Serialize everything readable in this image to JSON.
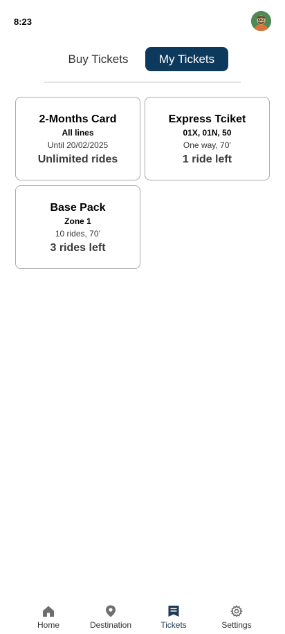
{
  "status_bar": {
    "time": "8:23"
  },
  "tabs": [
    {
      "label": "Buy Tickets",
      "active": false
    },
    {
      "label": "My Tickets",
      "active": true
    }
  ],
  "colors": {
    "accent": "#0d3a5c",
    "card_border": "#a9a9a9",
    "nav_active": "#1f3a56"
  },
  "tickets": [
    {
      "title": "2-Months Card",
      "lines": "All lines",
      "detail": "Until 20/02/2025",
      "rides": "Unlimited rides"
    },
    {
      "title": "Express Tciket",
      "lines": "01X, 01N, 50",
      "detail": "One way, 70’",
      "rides": "1 ride left"
    },
    {
      "title": "Base Pack",
      "lines": "Zone 1",
      "detail": "10 rides, 70’",
      "rides": "3 rides left"
    }
  ],
  "bottom_nav": [
    {
      "label": "Home",
      "icon": "home-icon"
    },
    {
      "label": "Destination",
      "icon": "location-pin-icon"
    },
    {
      "label": "Tickets",
      "icon": "ticket-icon",
      "active": true
    },
    {
      "label": "Settings",
      "icon": "gear-icon"
    }
  ]
}
